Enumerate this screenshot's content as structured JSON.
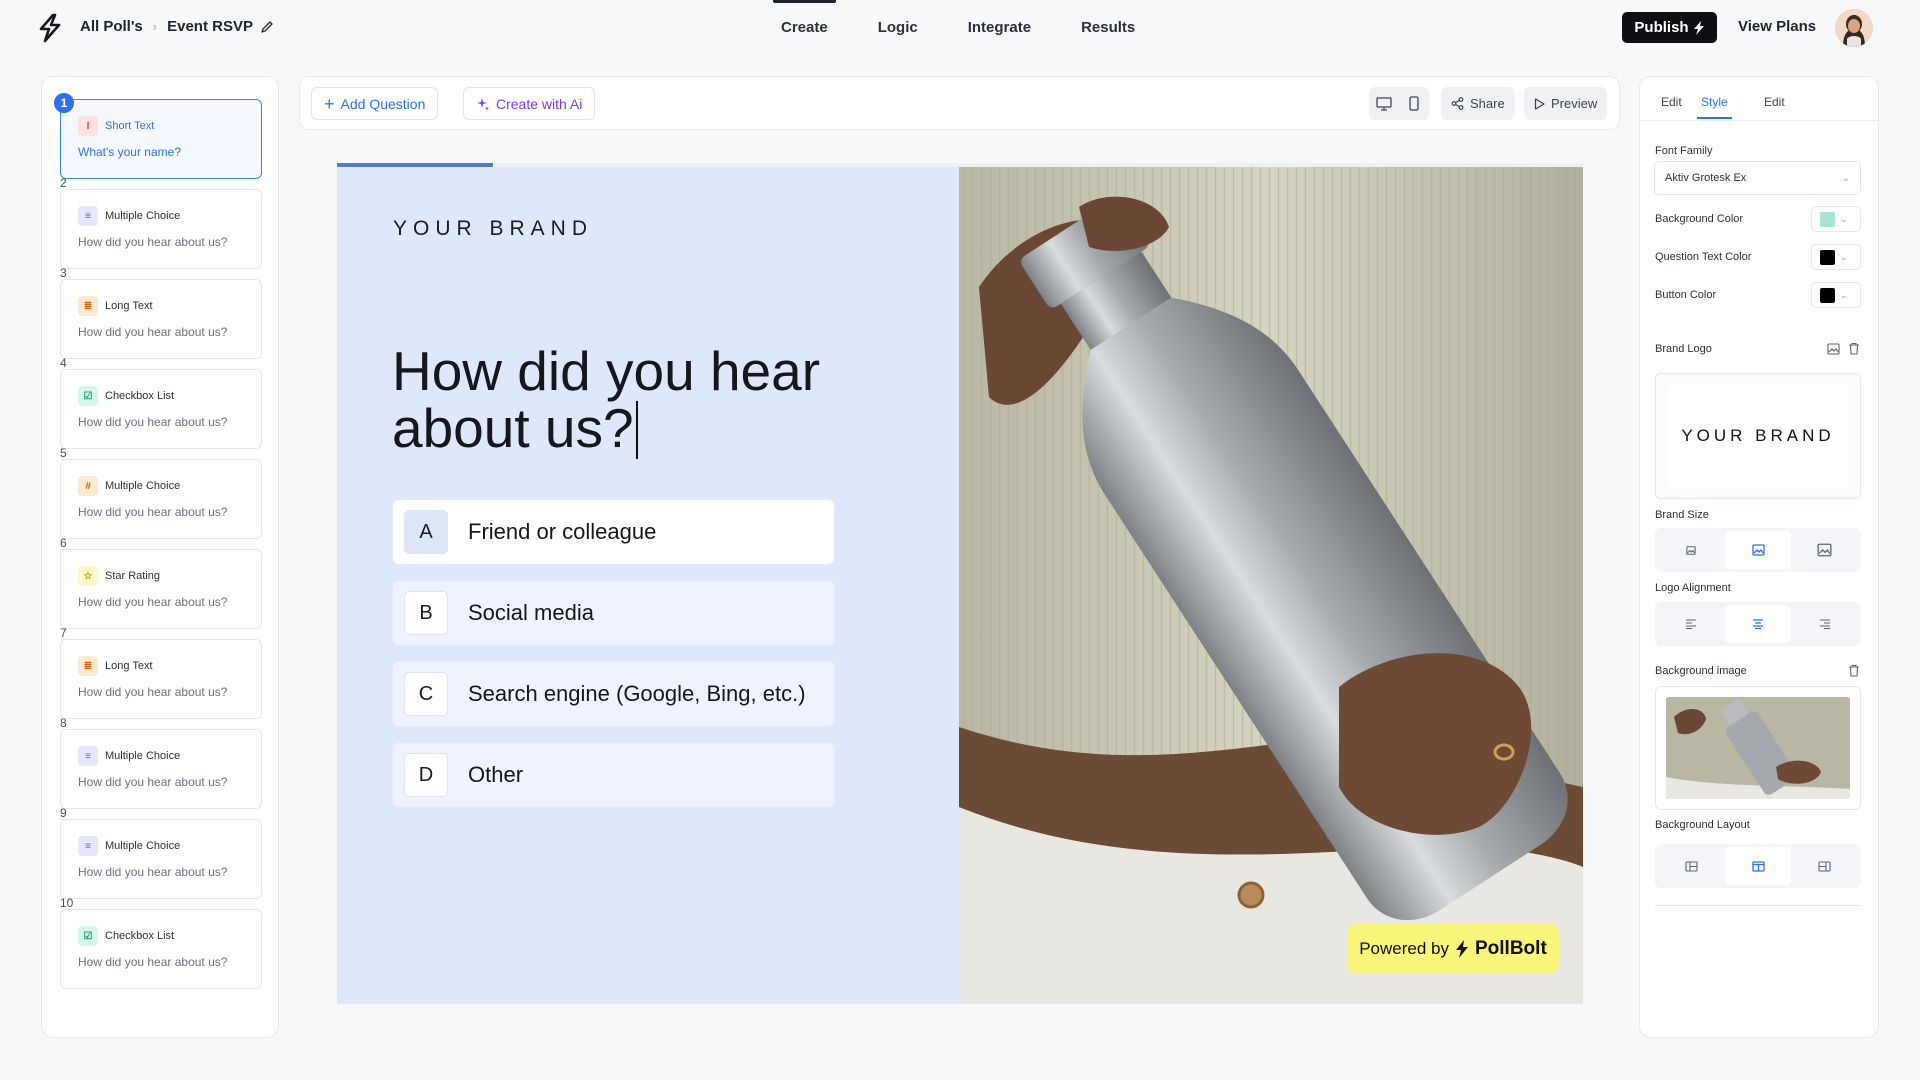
{
  "header": {
    "breadcrumb_root": "All Poll's",
    "breadcrumb_current": "Event RSVP",
    "tabs": [
      {
        "label": "Create",
        "active": true
      },
      {
        "label": "Logic",
        "active": false
      },
      {
        "label": "Integrate",
        "active": false
      },
      {
        "label": "Results",
        "active": false
      }
    ],
    "publish_label": "Publish",
    "view_plans_label": "View Plans"
  },
  "questions": [
    {
      "num": "1",
      "type": "Short Text",
      "icon": "text-cursor-icon",
      "icon_bg": "#fde2e2",
      "icon_fg": "#d04545",
      "glyph": "I",
      "text": "What's your name?",
      "active": true
    },
    {
      "num": "2",
      "type": "Multiple Choice",
      "icon": "list-icon",
      "icon_bg": "#e4e6fb",
      "icon_fg": "#5a5fd0",
      "glyph": "≡",
      "text": "How did you hear about us?",
      "active": false
    },
    {
      "num": "3",
      "type": "Long Text",
      "icon": "paragraph-icon",
      "icon_bg": "#fde9d3",
      "icon_fg": "#c46a14",
      "glyph": "≣",
      "text": "How did you hear about us?",
      "active": false
    },
    {
      "num": "4",
      "type": "Checkbox List",
      "icon": "checkbox-icon",
      "icon_bg": "#d8f5ea",
      "icon_fg": "#1f9d6e",
      "glyph": "☑",
      "text": "How did you hear about us?",
      "active": false
    },
    {
      "num": "5",
      "type": "Multiple Choice",
      "icon": "hash-icon",
      "icon_bg": "#fde9d3",
      "icon_fg": "#b85d10",
      "glyph": "#",
      "text": "How did you hear about us?",
      "active": false
    },
    {
      "num": "6",
      "type": "Star Rating",
      "icon": "star-icon",
      "icon_bg": "#fdf7c9",
      "icon_fg": "#b99a08",
      "glyph": "☆",
      "text": "How did you hear about us?",
      "active": false
    },
    {
      "num": "7",
      "type": "Long Text",
      "icon": "paragraph-icon",
      "icon_bg": "#fde9d3",
      "icon_fg": "#c46a14",
      "glyph": "≣",
      "text": "How did you hear about us?",
      "active": false
    },
    {
      "num": "8",
      "type": "Multiple Choice",
      "icon": "list-icon",
      "icon_bg": "#e4e6fb",
      "icon_fg": "#5a5fd0",
      "glyph": "≡",
      "text": "How did you hear about us?",
      "active": false
    },
    {
      "num": "9",
      "type": "Multiple Choice",
      "icon": "list-icon",
      "icon_bg": "#e4e6fb",
      "icon_fg": "#5a5fd0",
      "glyph": "≡",
      "text": "How did you hear about us?",
      "active": false
    },
    {
      "num": "10",
      "type": "Checkbox List",
      "icon": "checkbox-icon",
      "icon_bg": "#d8f5ea",
      "icon_fg": "#1f9d6e",
      "glyph": "☑",
      "text": "How did you hear about us?",
      "active": false
    }
  ],
  "toolbar": {
    "add_question": "Add Question",
    "create_ai": "Create with Ai",
    "share": "Share",
    "preview": "Preview"
  },
  "canvas": {
    "progress": 0.125,
    "brand": "YOUR BRAND",
    "question": "How did you hear about us?",
    "options": [
      {
        "key": "A",
        "label": "Friend or colleague",
        "selected": true
      },
      {
        "key": "B",
        "label": "Social media",
        "selected": false
      },
      {
        "key": "C",
        "label": "Search engine (Google, Bing, etc.)",
        "selected": false
      },
      {
        "key": "D",
        "label": "Other",
        "selected": false
      }
    ],
    "powered_prefix": "Powered by",
    "powered_brand": "PollBolt"
  },
  "style_panel": {
    "tabs": [
      {
        "label": "Edit",
        "active": false
      },
      {
        "label": "Style",
        "active": true
      },
      {
        "label": "Edit",
        "active": false
      }
    ],
    "font_family_label": "Font Family",
    "font_family_value": "Aktiv Grotesk Ex",
    "background_color_label": "Background Color",
    "background_color": "#a8e2d2",
    "question_text_color_label": "Question Text Color",
    "question_text_color": "#000000",
    "button_color_label": "Button Color",
    "button_color": "#000000",
    "brand_logo_label": "Brand Logo",
    "brand_logo_text": "YOUR BRAND",
    "brand_size_label": "Brand Size",
    "logo_alignment_label": "Logo Alignment",
    "background_image_label": "Background image",
    "background_layout_label": "Background Layout"
  }
}
